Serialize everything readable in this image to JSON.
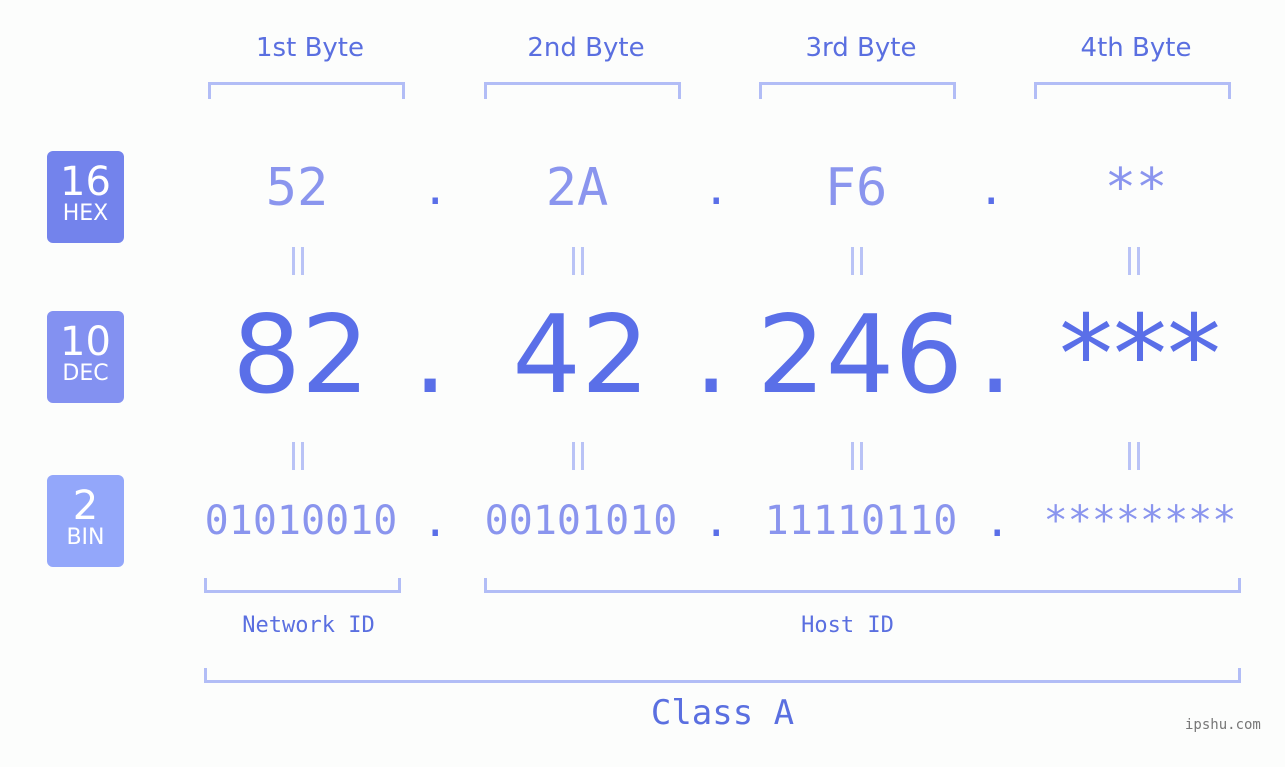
{
  "bytes": [
    "1st Byte",
    "2nd Byte",
    "3rd Byte",
    "4th Byte"
  ],
  "badges": {
    "hex": {
      "num": "16",
      "label": "HEX",
      "color": "#7383ec"
    },
    "dec": {
      "num": "10",
      "label": "DEC",
      "color": "#8391f1"
    },
    "bin": {
      "num": "2",
      "label": "BIN",
      "color": "#93a7fa"
    }
  },
  "hex": [
    "52",
    "2A",
    "F6",
    "**"
  ],
  "dec": [
    "82",
    "42",
    "246",
    "***"
  ],
  "bin": [
    "01010010",
    "00101010",
    "11110110",
    "********"
  ],
  "separator": ".",
  "network_id": "Network ID",
  "host_id": "Host ID",
  "ip_class": "Class A",
  "watermark": "ipshu.com"
}
